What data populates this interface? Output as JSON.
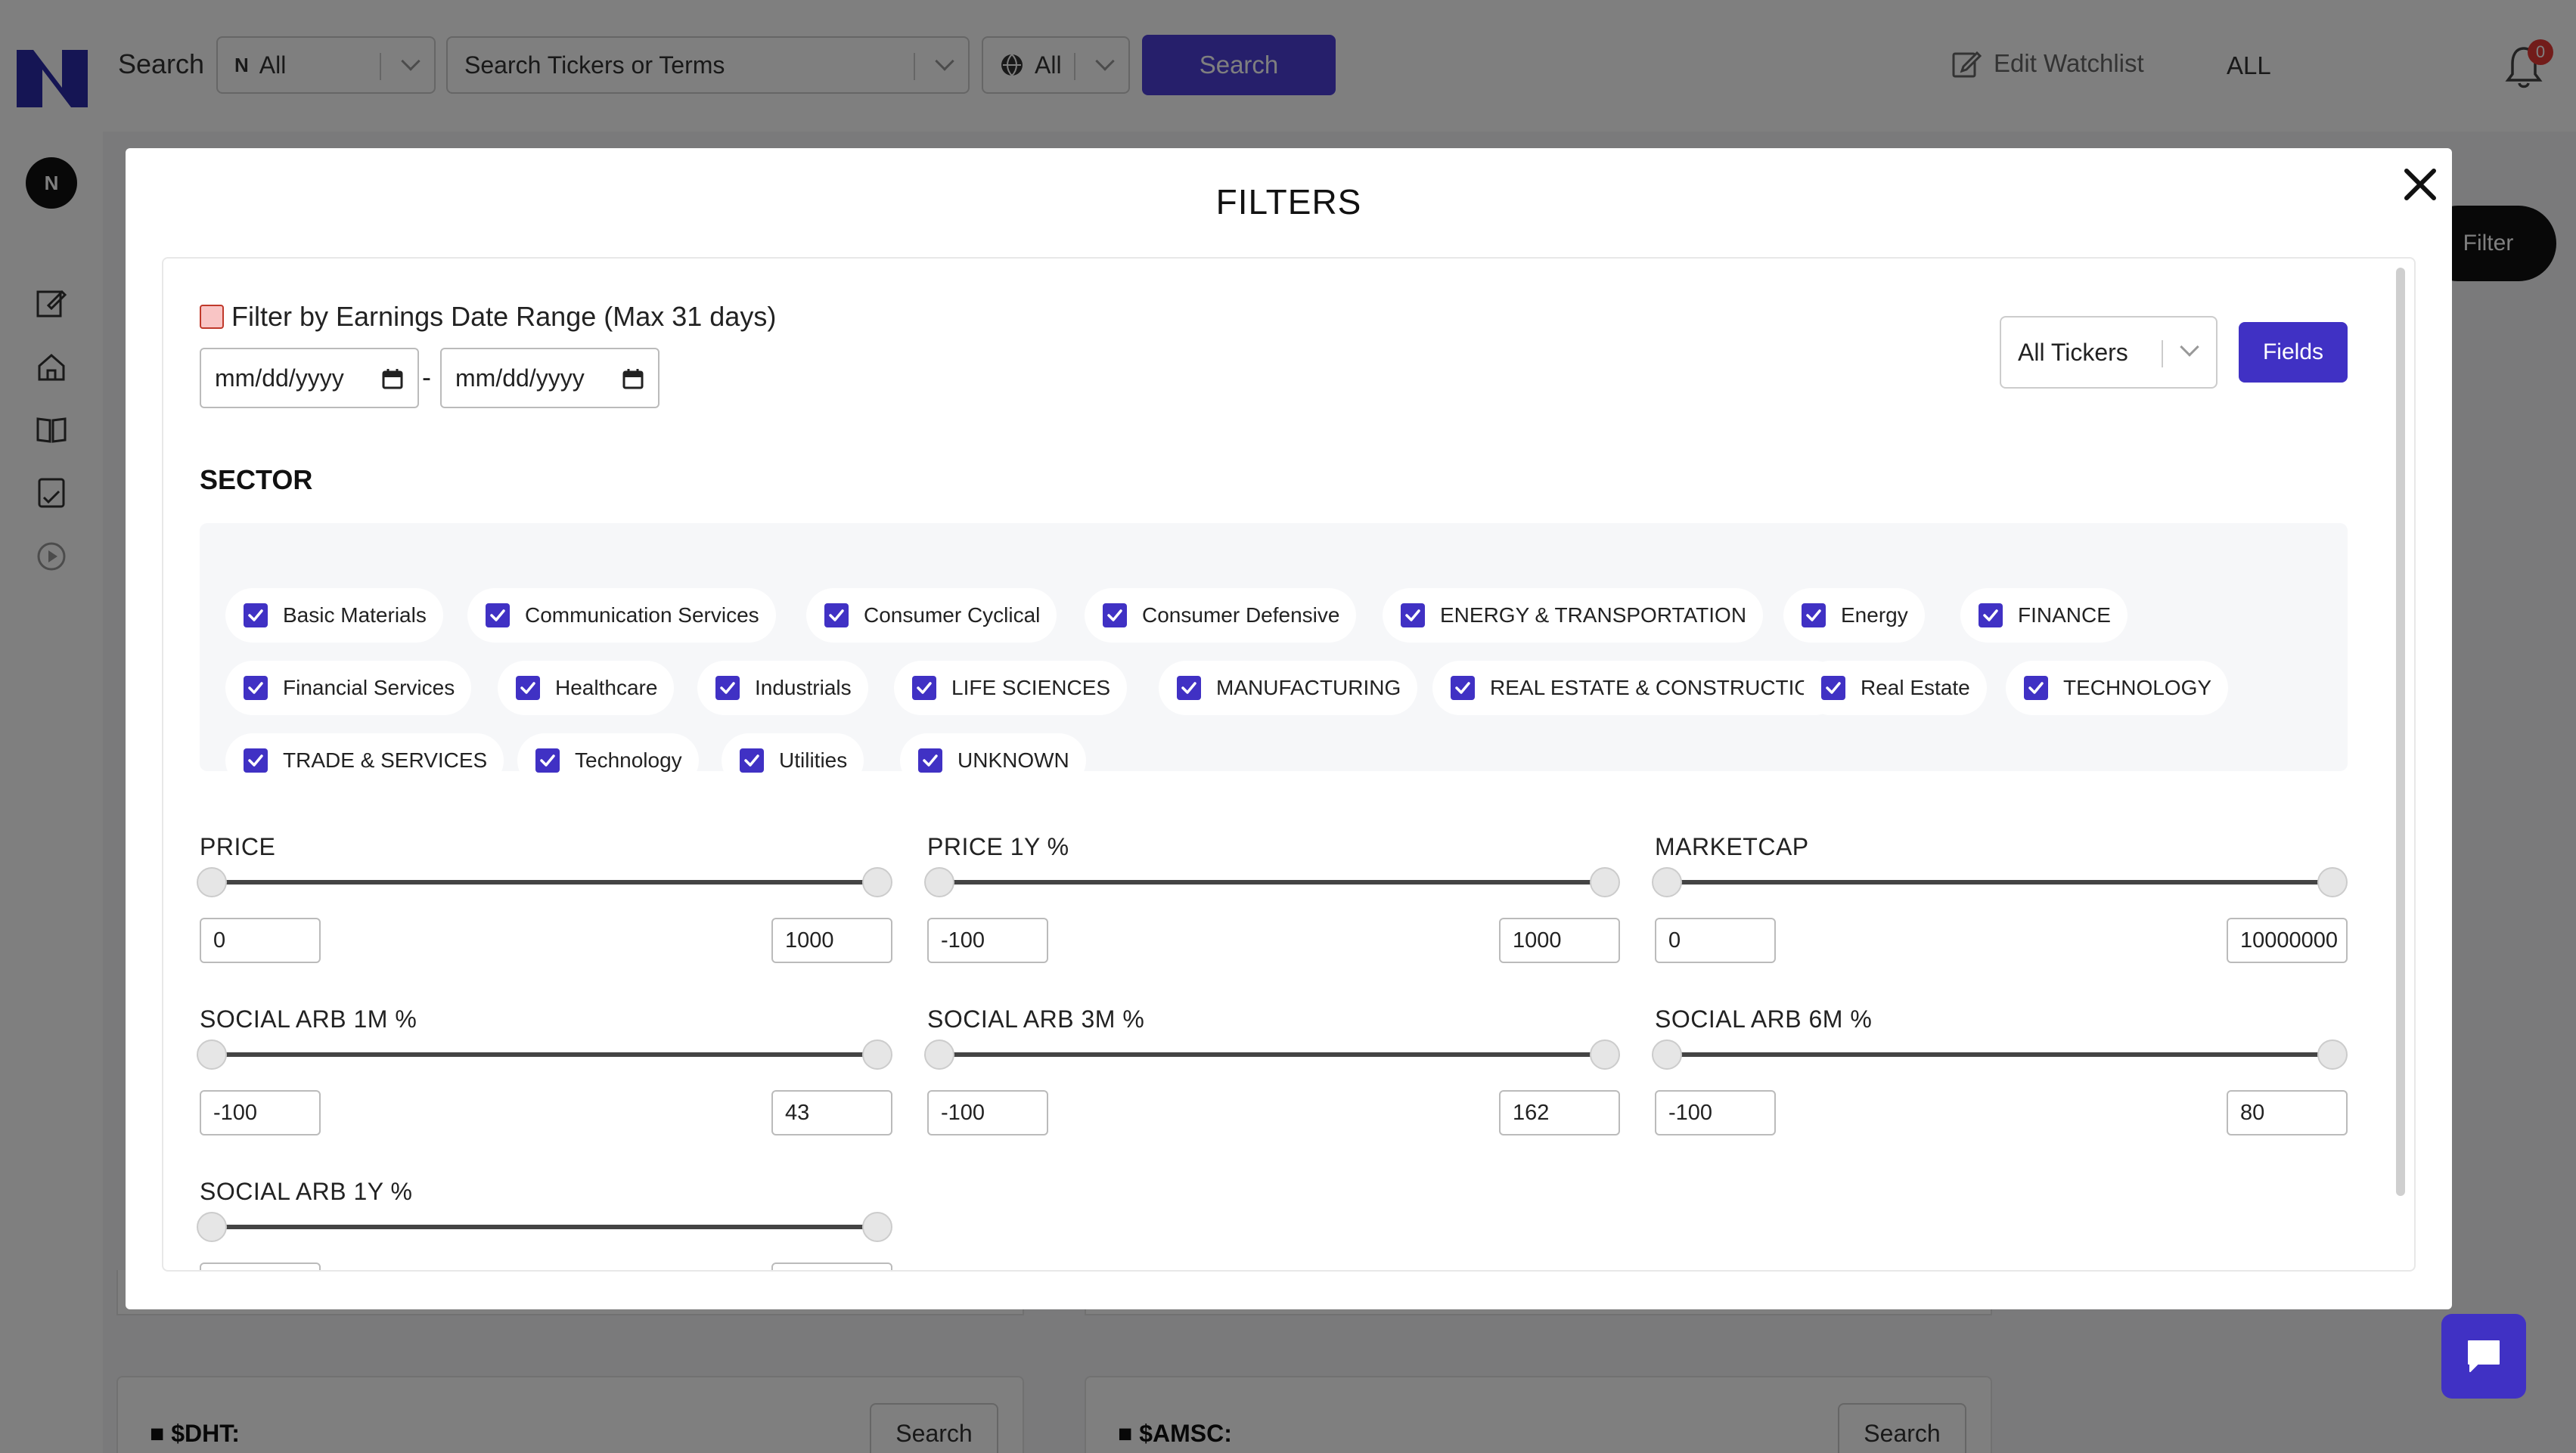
{
  "header": {
    "search_label": "Search",
    "market_select": "All",
    "ticker_search_placeholder": "Search Tickers or Terms",
    "region_select": "All",
    "search_button": "Search",
    "edit_watchlist": "Edit Watchlist",
    "watchlist_value": "ALL",
    "notification_count": "0"
  },
  "sidebar": {
    "avatar": "N"
  },
  "background": {
    "filter_button": "Filter",
    "cards": [
      {
        "ticker": "$DHT:",
        "button": "Search"
      },
      {
        "ticker": "$AMSC:",
        "button": "Search"
      }
    ]
  },
  "modal": {
    "title": "FILTERS",
    "earnings": {
      "label": "Filter by Earnings Date Range (Max 31 days)",
      "start_placeholder": "mm/dd/yyyy",
      "end_placeholder": "mm/dd/yyyy",
      "separator": "-"
    },
    "ticker_select": "All Tickers",
    "fields_button": "Fields",
    "sector_heading": "SECTOR",
    "sectors": [
      "Basic Materials",
      "Communication Services",
      "Consumer Cyclical",
      "Consumer Defensive",
      "ENERGY & TRANSPORTATION",
      "Energy",
      "FINANCE",
      "Financial Services",
      "Healthcare",
      "Industrials",
      "LIFE SCIENCES",
      "MANUFACTURING",
      "REAL ESTATE & CONSTRUCTION",
      "Real Estate",
      "TECHNOLOGY",
      "TRADE & SERVICES",
      "Technology",
      "Utilities",
      "UNKNOWN"
    ],
    "filters": [
      {
        "label": "PRICE",
        "min": "0",
        "max": "1000"
      },
      {
        "label": "PRICE 1Y %",
        "min": "-100",
        "max": "1000"
      },
      {
        "label": "MARKETCAP",
        "min": "0",
        "max": "10000000"
      },
      {
        "label": "SOCIAL ARB 1M %",
        "min": "-100",
        "max": "43"
      },
      {
        "label": "SOCIAL ARB 3M %",
        "min": "-100",
        "max": "162"
      },
      {
        "label": "SOCIAL ARB 6M %",
        "min": "-100",
        "max": "80"
      },
      {
        "label": "SOCIAL ARB 1Y %",
        "min": "",
        "max": ""
      }
    ]
  },
  "colors": {
    "accent": "#4031c4",
    "earnings_checkbox": "#f9c5c5"
  }
}
